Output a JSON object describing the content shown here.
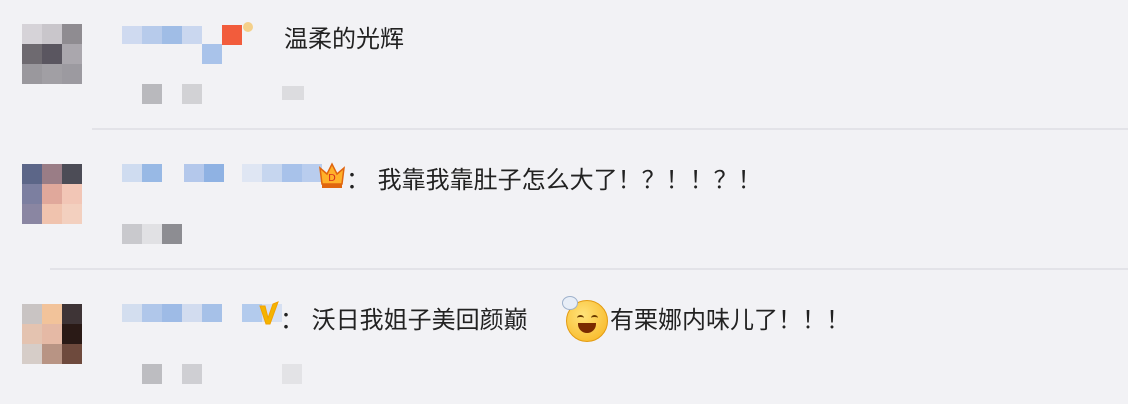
{
  "comments": [
    {
      "text": "温柔的光辉"
    },
    {
      "text": "：  我靠我靠肚子怎么大了！？！！？！"
    },
    {
      "text": "：  沃日我姐子美回颜巅",
      "text_after": "有栗娜内味儿了！！！"
    }
  ],
  "icons": [
    "avatar-mosaic",
    "crown-badge-icon",
    "grin-emoji-icon"
  ],
  "colors": {
    "background": "#f2f2f5",
    "text": "#222222",
    "divider": "#e3e3e8"
  }
}
